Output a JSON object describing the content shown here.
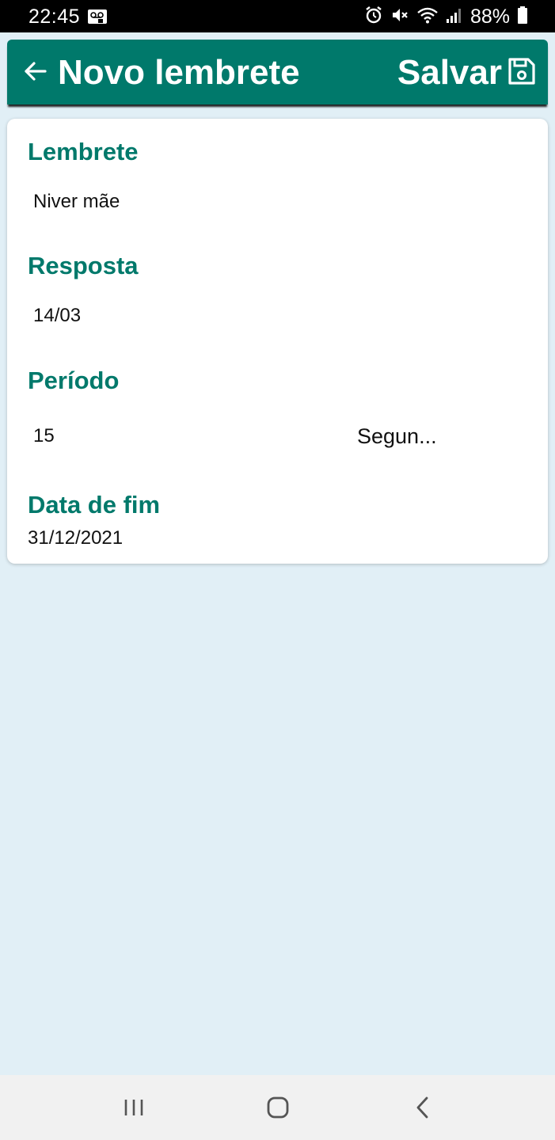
{
  "status_bar": {
    "time": "22:45",
    "battery_percent": "88%",
    "icons": [
      "voicemail-icon",
      "alarm-icon",
      "mute-icon",
      "wifi-icon",
      "signal-icon",
      "battery-icon"
    ]
  },
  "app_bar": {
    "title": "Novo lembrete",
    "save_label": "Salvar",
    "back_icon": "arrow-left-icon",
    "save_icon": "floppy-disk-icon",
    "background_color": "#00796b"
  },
  "form": {
    "lembrete": {
      "label": "Lembrete",
      "value": "Niver mãe"
    },
    "resposta": {
      "label": "Resposta",
      "value": "14/03"
    },
    "periodo": {
      "label": "Período",
      "value": "15",
      "unit": "Segun..."
    },
    "data_fim": {
      "label": "Data de fim",
      "value": "31/12/2021"
    }
  },
  "nav_bar": {
    "icons": [
      "recent-apps-icon",
      "home-icon",
      "back-icon"
    ]
  },
  "colors": {
    "accent": "#00796b",
    "background": "#e1eff6",
    "card": "#ffffff"
  }
}
